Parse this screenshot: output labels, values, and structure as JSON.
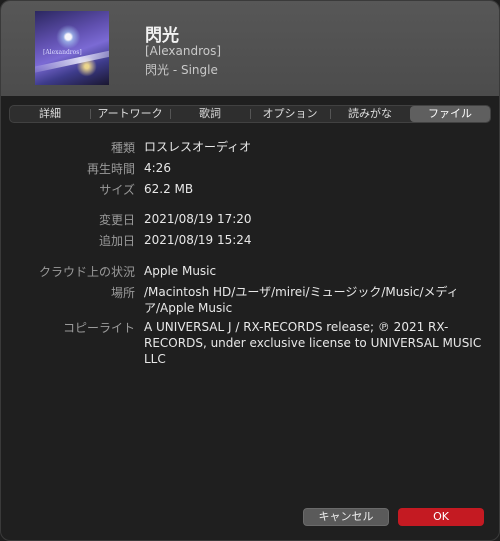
{
  "header": {
    "title": "閃光",
    "artist": "[Alexandros]",
    "album": "閃光 - Single",
    "artwork_text": "[Alexandros]"
  },
  "tabs": [
    {
      "label": "詳細",
      "active": false
    },
    {
      "label": "アートワーク",
      "active": false
    },
    {
      "label": "歌詞",
      "active": false
    },
    {
      "label": "オプション",
      "active": false
    },
    {
      "label": "読みがな",
      "active": false
    },
    {
      "label": "ファイル",
      "active": true
    }
  ],
  "file_info": {
    "kind_label": "種類",
    "kind_value": "ロスレスオーディオ",
    "duration_label": "再生時間",
    "duration_value": "4:26",
    "size_label": "サイズ",
    "size_value": "62.2 MB",
    "modified_label": "変更日",
    "modified_value": "2021/08/19 17:20",
    "added_label": "追加日",
    "added_value": "2021/08/19 15:24",
    "cloud_label": "クラウド上の状況",
    "cloud_value": "Apple Music",
    "location_label": "場所",
    "location_value": "/Macintosh HD/ユーザ/mirei/ミュージック/Music/メディア/Apple Music",
    "copyright_label": "コピーライト",
    "copyright_value": "A UNIVERSAL J / RX-RECORDS release; ℗ 2021 RX-RECORDS, under exclusive license to UNIVERSAL MUSIC LLC"
  },
  "buttons": {
    "cancel": "キャンセル",
    "ok": "OK"
  },
  "colors": {
    "ok_button": "#c41a22",
    "header_bg": "#4c4c4c",
    "body_bg": "#1f1f1f"
  }
}
